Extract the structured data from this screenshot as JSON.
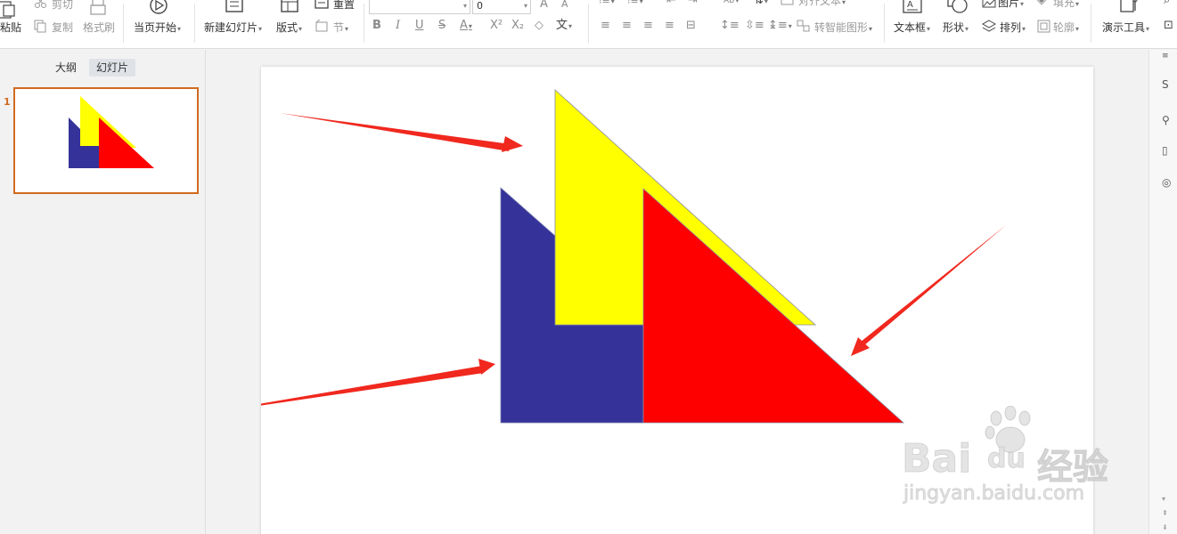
{
  "ribbon": {
    "clipboard": {
      "paste": "粘贴",
      "cut": "剪切",
      "copy": "复制",
      "format_painter": "格式刷"
    },
    "slideshow": {
      "from_current": "当页开始"
    },
    "slides": {
      "new_slide": "新建幻灯片",
      "layout": "版式",
      "reset": "重置",
      "section": "节"
    },
    "font": {
      "font_name": "",
      "font_size": "0"
    },
    "paragraph": {
      "align_text": "对齐文本",
      "smart_shape": "转智能图形"
    },
    "insert": {
      "text_box": "文本框",
      "shapes": "形状",
      "picture": "图片",
      "arrange": "排列",
      "fill": "填充",
      "outline": "轮廓"
    },
    "tools": {
      "presentation_tools": "演示工具"
    }
  },
  "left_panel": {
    "tabs": [
      "大纲",
      "幻灯片"
    ],
    "active_tab": "幻灯片",
    "slide_number": "1"
  },
  "slide": {
    "colors": {
      "yellow": "#ffff00",
      "red": "#ff0000",
      "navy": "#353399",
      "arrow": "#f0281e"
    }
  },
  "watermark": {
    "brand": "Bai",
    "brand2": "du",
    "site_cn": "经验",
    "url": "jingyan.baidu.com"
  }
}
